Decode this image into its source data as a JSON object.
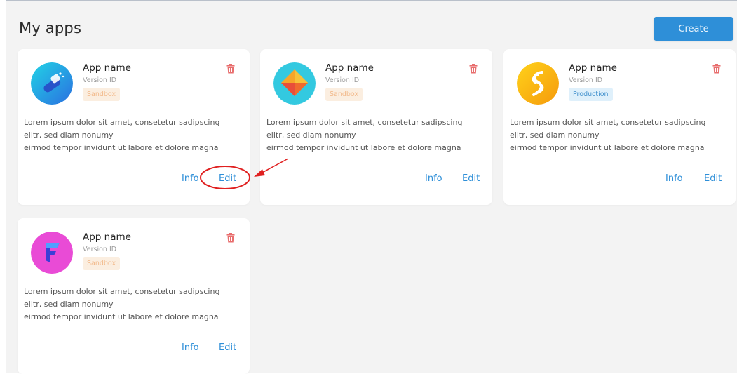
{
  "header": {
    "title": "My apps",
    "create_label": "Create"
  },
  "cards": [
    {
      "name": "App name",
      "version": "Version ID",
      "environment": "Sandbox",
      "description": [
        "Lorem ipsum dolor sit amet, consetetur sadipscing",
        "elitr, sed diam nonumy",
        "eirmod tempor invidunt ut labore et dolore magna"
      ],
      "info_label": "Info",
      "edit_label": "Edit",
      "icon": "wand-app-icon"
    },
    {
      "name": "App name",
      "version": "Version ID",
      "environment": "Sandbox",
      "description": [
        "Lorem ipsum dolor sit amet, consetetur sadipscing",
        "elitr, sed diam nonumy",
        "eirmod tempor invidunt ut labore et dolore magna"
      ],
      "info_label": "Info",
      "edit_label": "Edit",
      "icon": "diamond-app-icon"
    },
    {
      "name": "App name",
      "version": "Version ID",
      "environment": "Production",
      "description": [
        "Lorem ipsum dolor sit amet, consetetur sadipscing",
        "elitr, sed diam nonumy",
        "eirmod tempor invidunt ut labore et dolore magna"
      ],
      "info_label": "Info",
      "edit_label": "Edit",
      "icon": "swirl-app-icon"
    },
    {
      "name": "App name",
      "version": "Version ID",
      "environment": "Sandbox",
      "description": [
        "Lorem ipsum dolor sit amet, consetetur sadipscing",
        "elitr, sed diam nonumy",
        "eirmod tempor invidunt ut labore et dolore magna"
      ],
      "info_label": "Info",
      "edit_label": "Edit",
      "icon": "flag-app-icon"
    }
  ],
  "colors": {
    "accent": "#2e8fd8",
    "trash": "#e86e6e",
    "sandbox_bg": "#fbeee0",
    "sandbox_text": "#f2b98a",
    "production_bg": "#dff0fb",
    "production_text": "#3f8fcc",
    "annotation": "#e02020"
  }
}
